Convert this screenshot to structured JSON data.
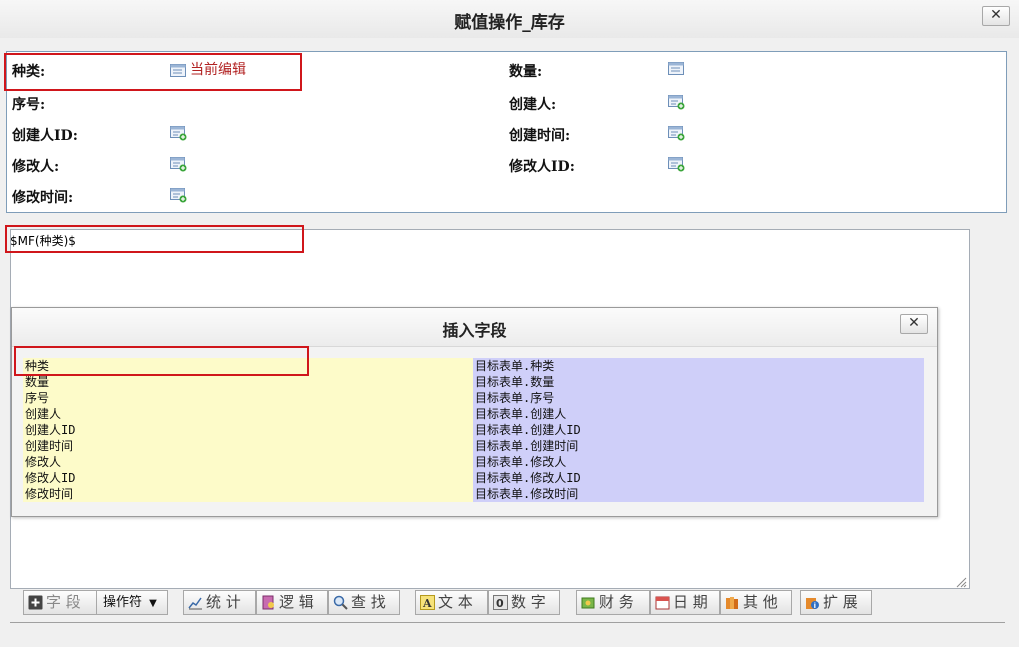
{
  "window": {
    "title": "赋值操作_库存",
    "close_label": "✕"
  },
  "fields": {
    "kind_label": "种类:",
    "current_edit": "当前编辑",
    "quantity_label": "数量:",
    "serial_label": "序号:",
    "creator_label": "创建人:",
    "creator_id_label": "创建人ID:",
    "create_time_label": "创建时间:",
    "modifier_label": "修改人:",
    "modifier_id_label": "修改人ID:",
    "modify_time_label": "修改时间:"
  },
  "editor": {
    "expression": "$MF(种类)$"
  },
  "dialog": {
    "title": "插入字段",
    "close_label": "✕",
    "rows": [
      {
        "name": "种类",
        "path": "目标表单.种类"
      },
      {
        "name": "数量",
        "path": "目标表单.数量"
      },
      {
        "name": "序号",
        "path": "目标表单.序号"
      },
      {
        "name": "创建人",
        "path": "目标表单.创建人"
      },
      {
        "name": "创建人ID",
        "path": "目标表单.创建人ID"
      },
      {
        "name": "创建时间",
        "path": "目标表单.创建时间"
      },
      {
        "name": "修改人",
        "path": "目标表单.修改人"
      },
      {
        "name": "修改人ID",
        "path": "目标表单.修改人ID"
      },
      {
        "name": "修改时间",
        "path": "目标表单.修改时间"
      }
    ]
  },
  "toolbar": {
    "field": "字 段",
    "operator": "操作符",
    "stats": "统 计",
    "logic": "逻 辑",
    "find": "查 找",
    "text": "文 本",
    "number": "数 字",
    "finance": "财 务",
    "date": "日 期",
    "other": "其 他",
    "extend": "扩 展"
  },
  "colors": {
    "highlight_red": "#d0161b",
    "name_column_bg": "#fdfbc9",
    "path_column_bg": "#cfcff9"
  }
}
